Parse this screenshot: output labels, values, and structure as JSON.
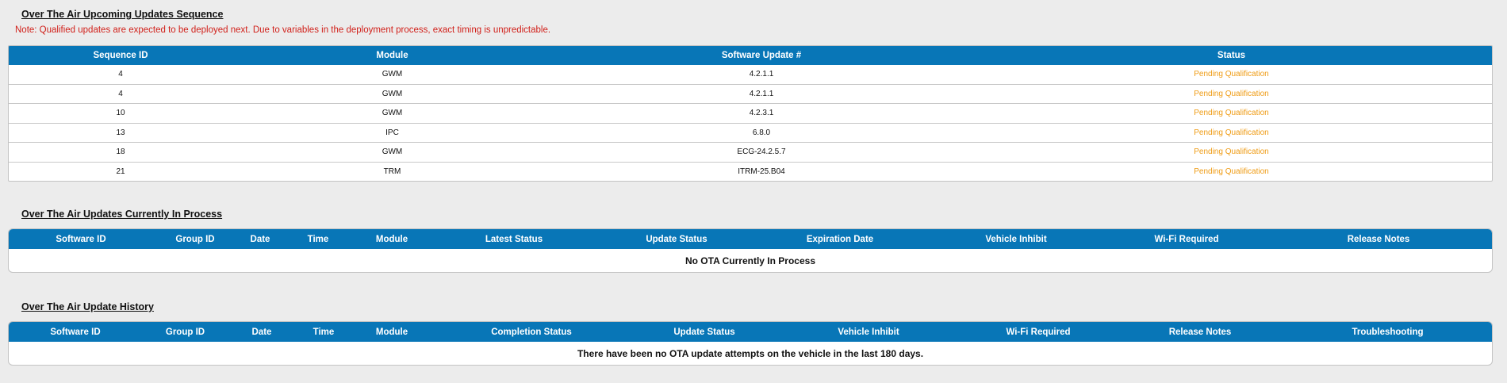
{
  "upcoming": {
    "title": "Over The Air Upcoming Updates Sequence",
    "note": "Note: Qualified updates are expected to be deployed next. Due to variables in the deployment process, exact timing is unpredictable.",
    "headers": [
      "Sequence ID",
      "Module",
      "Software Update #",
      "Status"
    ],
    "rows": [
      {
        "sequence_id": "4",
        "module": "GWM",
        "software_update": "4.2.1.1",
        "status": "Pending Qualification"
      },
      {
        "sequence_id": "4",
        "module": "GWM",
        "software_update": "4.2.1.1",
        "status": "Pending Qualification"
      },
      {
        "sequence_id": "10",
        "module": "GWM",
        "software_update": "4.2.3.1",
        "status": "Pending Qualification"
      },
      {
        "sequence_id": "13",
        "module": "IPC",
        "software_update": "6.8.0",
        "status": "Pending Qualification"
      },
      {
        "sequence_id": "18",
        "module": "GWM",
        "software_update": "ECG-24.2.5.7",
        "status": "Pending Qualification"
      },
      {
        "sequence_id": "21",
        "module": "TRM",
        "software_update": "ITRM-25.B04",
        "status": "Pending Qualification"
      }
    ],
    "status_color": "#ef9b13"
  },
  "in_process": {
    "title": "Over The Air Updates Currently In Process",
    "headers": [
      "Software ID",
      "Group ID",
      "Date",
      "Time",
      "Module",
      "Latest Status",
      "Update Status",
      "Expiration Date",
      "Vehicle Inhibit",
      "Wi-Fi Required",
      "Release Notes"
    ],
    "empty_message": "No OTA Currently In Process"
  },
  "history": {
    "title": "Over The Air Update History",
    "headers": [
      "Software ID",
      "Group ID",
      "Date",
      "Time",
      "Module",
      "Completion Status",
      "Update Status",
      "Vehicle Inhibit",
      "Wi-Fi Required",
      "Release Notes",
      "Troubleshooting"
    ],
    "empty_message": "There have been no OTA update attempts on the vehicle in the last 180 days."
  },
  "colors": {
    "header_bg": "#0876b7",
    "page_bg": "#ececec",
    "note_text": "#d1201a"
  }
}
